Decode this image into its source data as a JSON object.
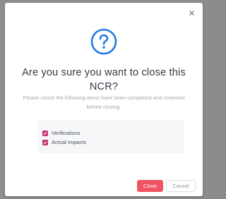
{
  "dialog": {
    "title": "Are you sure you want to close this NCR?",
    "message": "Please check the following items have been completed and reviewed before closing.",
    "checklist": [
      {
        "label": "Verifications",
        "checked": true
      },
      {
        "label": "Actual Impacts",
        "checked": true
      }
    ],
    "buttons": {
      "confirm_label": "Close",
      "cancel_label": "Cancel"
    },
    "icons": {
      "dismiss": "close-icon",
      "header": "question-circle-icon",
      "checkbox": "check-icon"
    }
  },
  "colors": {
    "accent_blue": "#1e7be0",
    "checkbox": "#c4366f",
    "confirm_button": "#f05361"
  }
}
